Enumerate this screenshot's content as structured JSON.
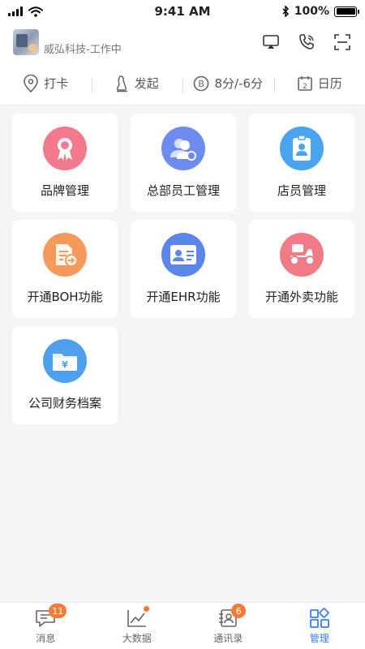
{
  "status": {
    "time": "9:41 AM",
    "battery": "100%"
  },
  "header": {
    "company": "威弘科技-工作中"
  },
  "quick": [
    {
      "label": "打卡",
      "icon": "location-pin-icon"
    },
    {
      "label": "发起",
      "icon": "send-icon"
    },
    {
      "label": "8分/-6分",
      "icon": "score-coin-icon"
    },
    {
      "label": "日历",
      "icon": "calendar-icon"
    }
  ],
  "cards": [
    {
      "label": "品牌管理",
      "icon": "ribbon-icon",
      "color": "#f27a8c"
    },
    {
      "label": "总部员工管理",
      "icon": "people-gear-icon",
      "color": "#6e8cef"
    },
    {
      "label": "店员管理",
      "icon": "id-badge-icon",
      "color": "#4aa3ee"
    },
    {
      "label": "开通BOH功能",
      "icon": "document-arrow-icon",
      "color": "#f59a5a"
    },
    {
      "label": "开通EHR功能",
      "icon": "id-card-icon",
      "color": "#5a86ea"
    },
    {
      "label": "开通外卖功能",
      "icon": "scooter-icon",
      "color": "#f07a86"
    },
    {
      "label": "公司财务档案",
      "icon": "finance-folder-icon",
      "color": "#4f9ff0"
    }
  ],
  "tabs": [
    {
      "label": "消息",
      "badge": "11"
    },
    {
      "label": "大数据"
    },
    {
      "label": "通讯录",
      "badge": "6"
    },
    {
      "label": "管理"
    }
  ],
  "colors": {
    "accent": "#3a7bf2",
    "badge": "#f47a36"
  }
}
